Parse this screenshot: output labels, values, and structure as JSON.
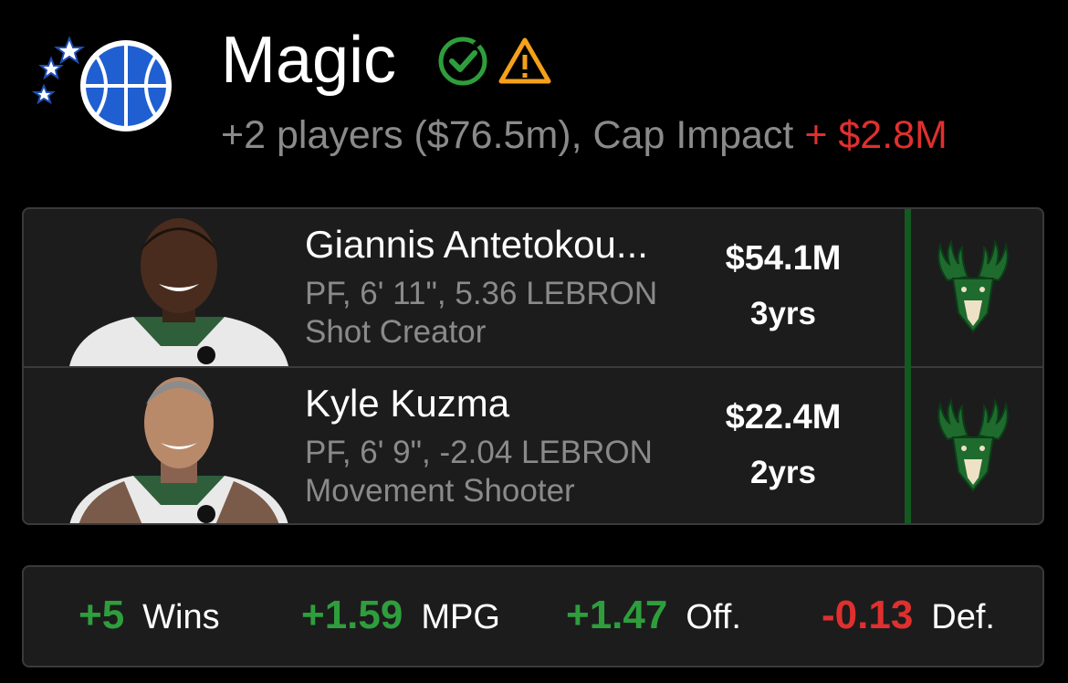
{
  "team": {
    "name": "Magic",
    "summary": "+2 players ($76.5m), Cap Impact ",
    "cap_impact": "+ $2.8M",
    "logo_icon": "orlando-magic-logo",
    "status_icons": [
      "check-circle-icon",
      "warning-icon"
    ]
  },
  "players": [
    {
      "name": "Giannis Antetokou...",
      "info": "PF, 6' 11\", 5.36 LEBRON",
      "role": "Shot Creator",
      "salary": "$54.1M",
      "years": "3yrs",
      "team_icon": "bucks-logo"
    },
    {
      "name": "Kyle Kuzma",
      "info": "PF, 6' 9\", -2.04 LEBRON",
      "role": "Movement Shooter",
      "salary": "$22.4M",
      "years": "2yrs",
      "team_icon": "bucks-logo"
    }
  ],
  "stats": [
    {
      "value": "+5",
      "label": "Wins",
      "color": "#2e9e3c"
    },
    {
      "value": "+1.59",
      "label": "MPG",
      "color": "#2e9e3c"
    },
    {
      "value": "+1.47",
      "label": "Off.",
      "color": "#2e9e3c"
    },
    {
      "value": "-0.13",
      "label": "Def.",
      "color": "#e0302e"
    }
  ],
  "colors": {
    "background": "#000000",
    "card": "#1c1c1d",
    "positive": "#2e9e3c",
    "negative": "#e0302e",
    "bucks_green": "#135a20",
    "muted_text": "#8a8a8a"
  }
}
